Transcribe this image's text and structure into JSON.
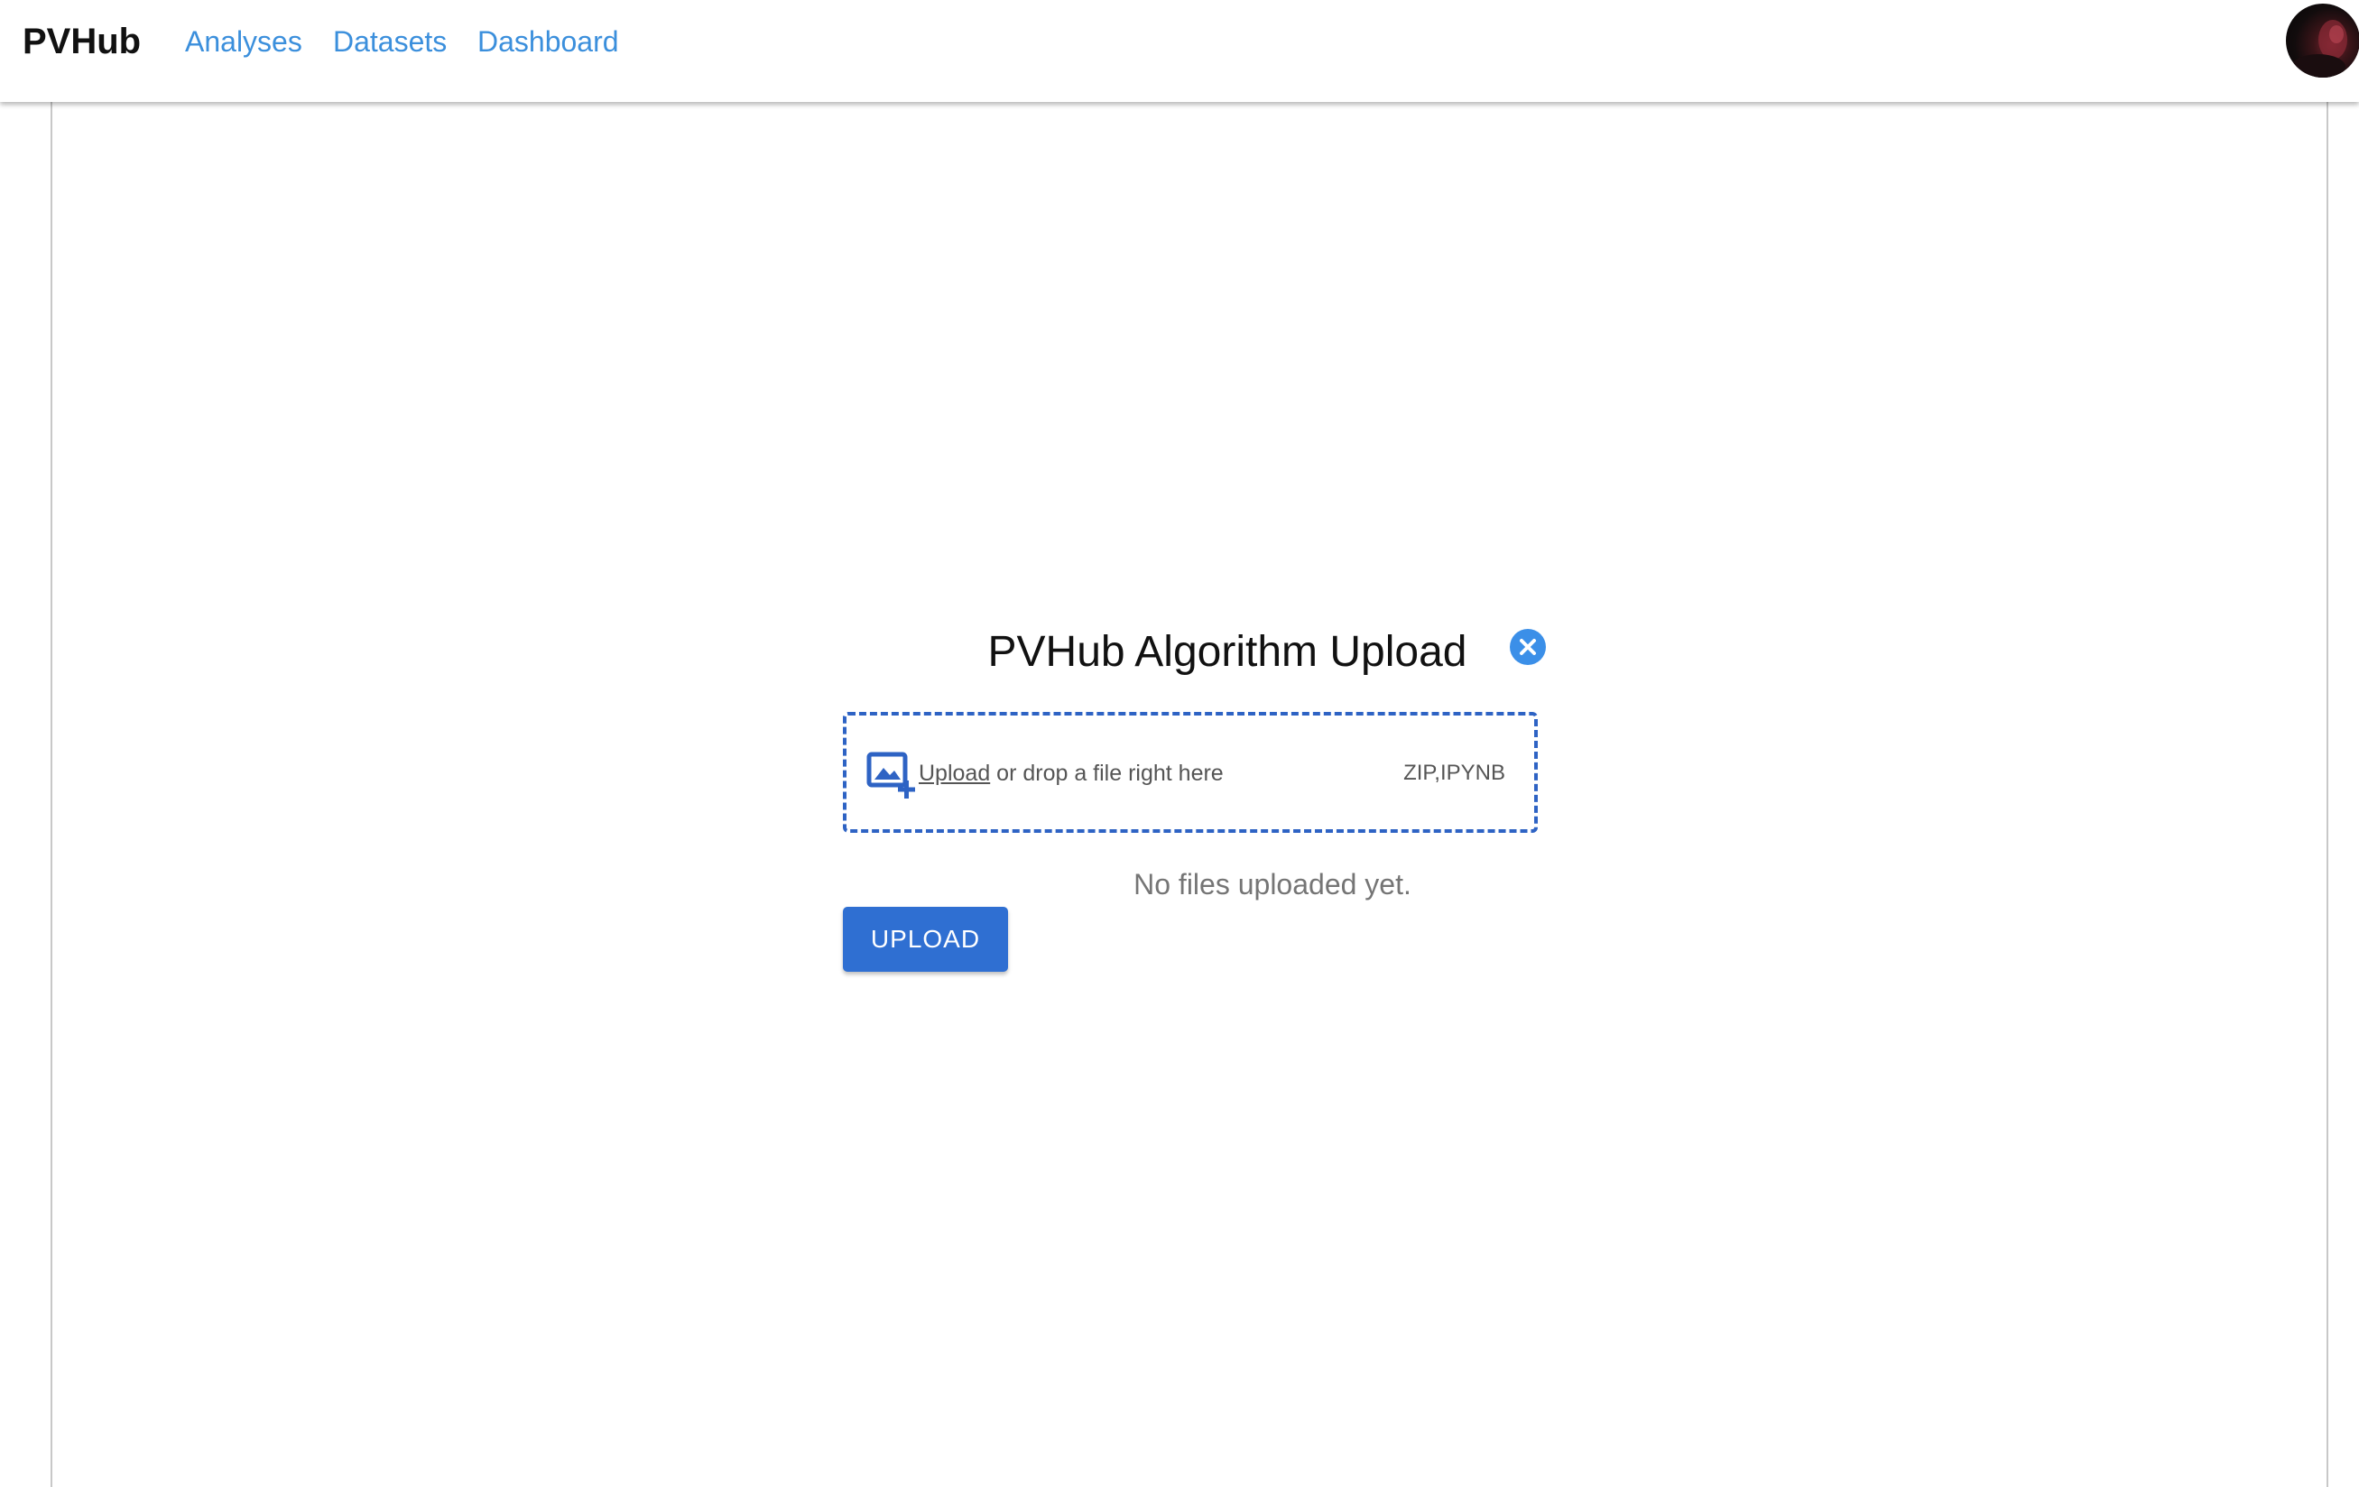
{
  "navbar": {
    "brand": "PVHub",
    "links": [
      {
        "label": "Analyses"
      },
      {
        "label": "Datasets"
      },
      {
        "label": "Dashboard"
      }
    ],
    "avatar_icon": "user-avatar"
  },
  "dialog": {
    "title": "PVHub Algorithm Upload",
    "close_icon": "close-circle-icon",
    "dropzone": {
      "icon": "add-image-icon",
      "link_label": "Upload",
      "hint_text": " or drop a file right here",
      "file_types": "ZIP,IPYNB"
    },
    "status": "No files uploaded yet.",
    "upload_button_label": "UPLOAD"
  },
  "colors": {
    "brand_text": "#111111",
    "nav_link": "#3b8fdc",
    "dropzone_border": "#2e63c4",
    "close_button": "#3b8fe8",
    "primary_button": "#2f6fd2",
    "status_text": "#757575"
  }
}
